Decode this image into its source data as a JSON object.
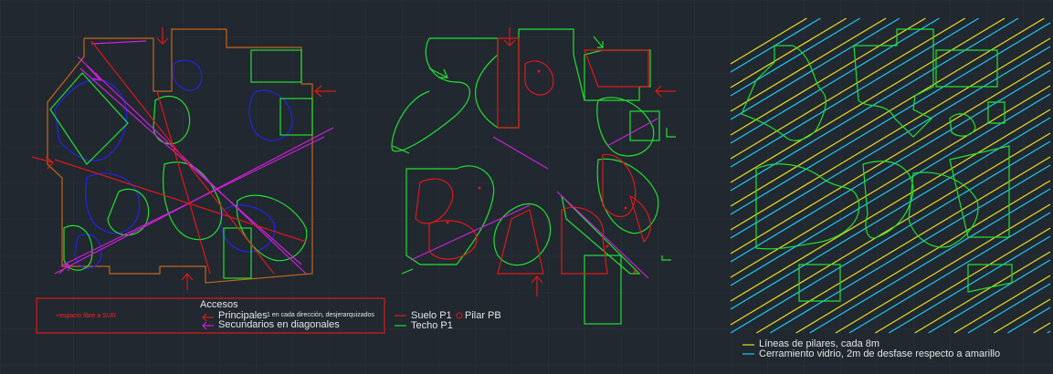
{
  "colors": {
    "background": "#212830",
    "grid": "#2a323b",
    "green": "#22e030",
    "red": "#e01818",
    "orange": "#c86418",
    "blue": "#2424e8",
    "magenta": "#d020d8",
    "yellow": "#e8e020",
    "cyan": "#20c8f0",
    "text": "#e6e6e6"
  },
  "legend_accesos": {
    "note": "+espacio libre a SUR",
    "title": "Accesos",
    "principales": "Principales",
    "principales_note": "1 en cada dirección, desjerarquizados",
    "secundarios": "Secundarios en diagonales"
  },
  "legend_floors": {
    "suelo": "Suelo P1",
    "pilar": "Pilar PB",
    "techo": "Techo P1"
  },
  "legend_pillars": {
    "lineas": "Líneas de pilares, cada 8m",
    "cerramiento": "Cerramiento vidrio, 2m de desfase respecto a amarillo"
  }
}
